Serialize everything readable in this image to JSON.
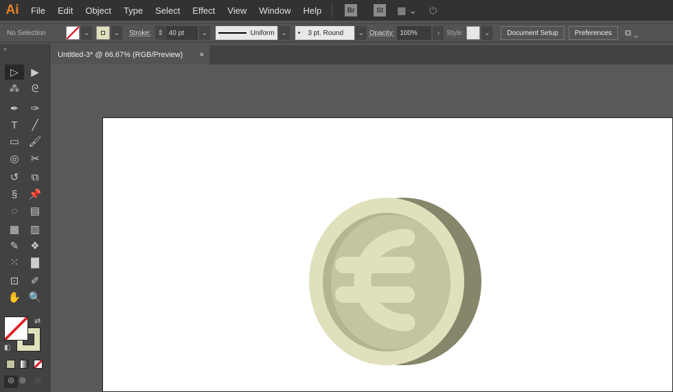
{
  "app": {
    "logo": "Ai"
  },
  "menu": [
    "File",
    "Edit",
    "Object",
    "Type",
    "Select",
    "Effect",
    "View",
    "Window",
    "Help"
  ],
  "menu_icons": {
    "bridge": "Br",
    "stock": "St"
  },
  "control": {
    "selection": "No Selection",
    "stroke_label": "Stroke:",
    "stroke_value": "40 pt",
    "profile": "Uniform",
    "brush": "3 pt. Round",
    "opacity_label": "Opacity:",
    "opacity_value": "100%",
    "style_label": "Style:",
    "document_setup": "Document Setup",
    "preferences": "Preferences"
  },
  "document_tab": {
    "title": "Untitled-3* @ 66.67% (RGB/Preview)",
    "close": "×"
  },
  "colors": {
    "fill": "#e0e0bc",
    "coin_edge": "#86866a",
    "coin_ring": "#b4b492",
    "coin_face": "#c4c4a0",
    "stroke_none": "#d9232b"
  },
  "tools": [
    "selection",
    "direct-selection",
    "magic-wand",
    "lasso",
    "pen",
    "curvature",
    "type",
    "line",
    "rectangle",
    "paintbrush",
    "shaper",
    "scissors",
    "rotate",
    "scale",
    "warp",
    "puppet-warp",
    "shape-builder",
    "perspective-grid",
    "mesh",
    "gradient",
    "eyedropper",
    "blend",
    "symbol-sprayer",
    "column-graph",
    "artboard",
    "slice",
    "hand",
    "zoom"
  ]
}
